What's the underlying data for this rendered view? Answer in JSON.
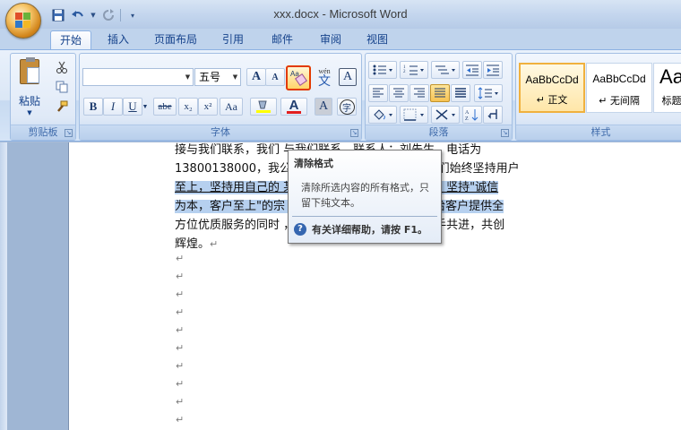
{
  "window": {
    "title": "xxx.docx - Microsoft Word"
  },
  "quick_access": {
    "icons": [
      "save-icon",
      "undo-icon",
      "redo-icon",
      "customize-icon"
    ]
  },
  "tabs": [
    {
      "label": "开始",
      "active": true
    },
    {
      "label": "插入"
    },
    {
      "label": "页面布局"
    },
    {
      "label": "引用"
    },
    {
      "label": "邮件"
    },
    {
      "label": "审阅"
    },
    {
      "label": "视图"
    }
  ],
  "ribbon": {
    "clipboard": {
      "label": "剪贴板",
      "paste_label": "粘贴"
    },
    "font": {
      "label": "字体",
      "font_name": "",
      "font_size": "五号",
      "grow_font": "A",
      "shrink_font": "A",
      "bold": "B",
      "italic": "I",
      "underline": "U",
      "strike": "abe",
      "subscript": "x₂",
      "superscript": "x²",
      "change_case": "Aa",
      "font_color": "A",
      "char_shading": "A",
      "wen": "wén",
      "wen_char": "文",
      "char_border": "A",
      "enclose": "字",
      "clear_format_icon": "Aa"
    },
    "paragraph": {
      "label": "段落"
    },
    "styles": {
      "label": "样式",
      "items": [
        {
          "sample": "AaBbCcDd",
          "name": "↵ 正文",
          "selected": true
        },
        {
          "sample": "AaBbCcDd",
          "name": "↵ 无间隔",
          "selected": false
        },
        {
          "sample": "Aa",
          "name": "标题",
          "selected": false
        }
      ]
    }
  },
  "document": {
    "lines": [
      "接与我们联系，我们                              与我们联系，联系人：刘先生，电话为",
      "13800138000，我公司                   司发展壮大的 2 年里，我们始终坚持用户",
      "至上，坚持用自己的                   某信息科技有限公司创建以来，坚持\"诚信",
      "为本，客户至上\"的宗                  求精\"的经营销售理念，力求给客户提供全",
      "方位优质服务的同时                   ，期待与各位业界新老客户携手共进，共创",
      "辉煌。"
    ],
    "para_mark": "↵"
  },
  "tooltip": {
    "title": "清除格式",
    "description": "清除所选内容的所有格式，只留下纯文本。",
    "help": "有关详细帮助，请按 F1。"
  }
}
